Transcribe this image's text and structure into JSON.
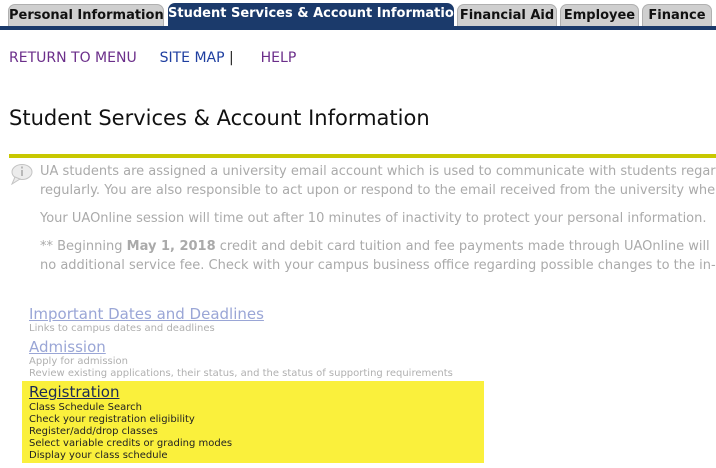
{
  "tabs": [
    {
      "label": "Personal Information",
      "active": false
    },
    {
      "label": "Student Services & Account Information",
      "active": true
    },
    {
      "label": "Financial Aid",
      "active": false
    },
    {
      "label": "Employee",
      "active": false
    },
    {
      "label": "Finance",
      "active": false
    }
  ],
  "top_links": {
    "return_to_menu": "RETURN TO MENU",
    "site_map": "SITE MAP",
    "separator": "|",
    "help": "HELP"
  },
  "page_title": "Student Services & Account Information",
  "info": {
    "line1": "UA students are assigned a university email account which is used to communicate with students regarding",
    "line2": "regularly. You are also responsible to act upon or respond to the email received from the university whe",
    "line3": "Your UAOnline session will time out after 10 minutes of inactivity to protect your personal information.",
    "line4_prefix": "** Beginning ",
    "line4_bold": "May 1, 2018",
    "line4_suffix": " credit and debit card tuition and fee payments made through UAOnline will",
    "line5": "no additional service fee. Check with your campus business office regarding possible changes to the in-"
  },
  "menu": {
    "important_dates": {
      "label": "Important Dates and Deadlines",
      "desc": "Links to campus dates and deadlines"
    },
    "admission": {
      "label": "Admission",
      "desc1": "Apply for admission",
      "desc2": "Review existing applications, their status, and the status of supporting requirements"
    },
    "registration": {
      "label": "Registration",
      "items": [
        "Class Schedule Search",
        "Check your registration eligibility",
        "Register/add/drop classes",
        "Select variable credits or grading modes",
        "Display your class schedule"
      ]
    }
  },
  "colors": {
    "tab_active": "#1b3a6b",
    "rule": "#c8c800",
    "highlight": "#faf03c"
  }
}
